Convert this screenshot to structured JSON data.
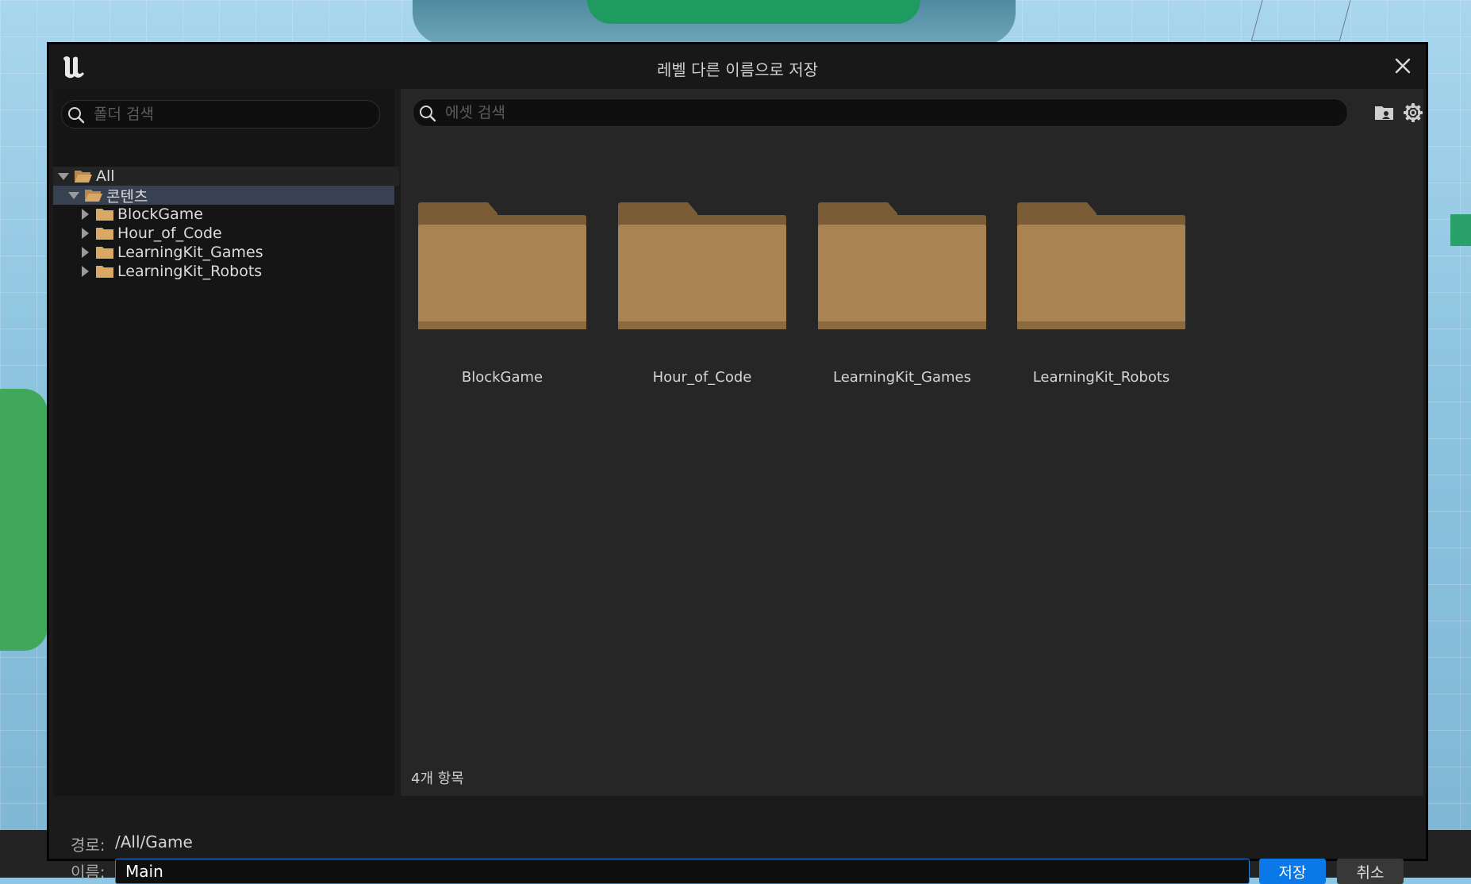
{
  "dialog": {
    "title": "레벨 다른 이름으로 저장"
  },
  "folder_search": {
    "placeholder": "폴더 검색"
  },
  "asset_search": {
    "placeholder": "에셋 검색"
  },
  "tree": {
    "root": "All",
    "content": "콘텐츠",
    "children": [
      "BlockGame",
      "Hour_of_Code",
      "LearningKit_Games",
      "LearningKit_Robots"
    ]
  },
  "assets": {
    "items": [
      "BlockGame",
      "Hour_of_Code",
      "LearningKit_Games",
      "LearningKit_Robots"
    ],
    "count_label": "4개 항목"
  },
  "footer": {
    "path_label": "경로:",
    "path_value": "/All/Game",
    "name_label": "이름:",
    "name_value": "Main",
    "save_label": "저장",
    "cancel_label": "취소"
  },
  "colors": {
    "accent": "#0a78e6",
    "folder": "#a98452",
    "selection": "#384152"
  }
}
